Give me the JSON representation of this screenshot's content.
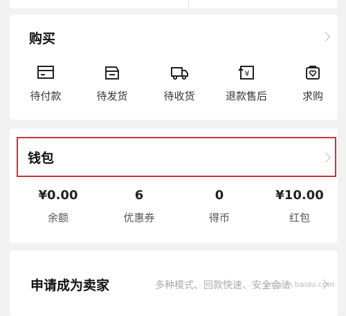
{
  "buy": {
    "title": "购买",
    "items": [
      {
        "label": "待付款",
        "icon": "card-icon"
      },
      {
        "label": "待发货",
        "icon": "package-icon"
      },
      {
        "label": "待收货",
        "icon": "truck-icon"
      },
      {
        "label": "退款售后",
        "icon": "refund-icon"
      },
      {
        "label": "求购",
        "icon": "want-buy-icon"
      }
    ]
  },
  "wallet": {
    "title": "钱包",
    "highlight_color": "#c8323a",
    "stats": [
      {
        "value": "¥0.00",
        "label": "余额"
      },
      {
        "value": "6",
        "label": "优惠券"
      },
      {
        "value": "0",
        "label": "得币"
      },
      {
        "value": "¥10.00",
        "label": "红包"
      }
    ]
  },
  "seller": {
    "title": "申请成为卖家",
    "description": "多种模式、回款快速、安全合法"
  },
  "watermark": "jingyan.baidu.com"
}
